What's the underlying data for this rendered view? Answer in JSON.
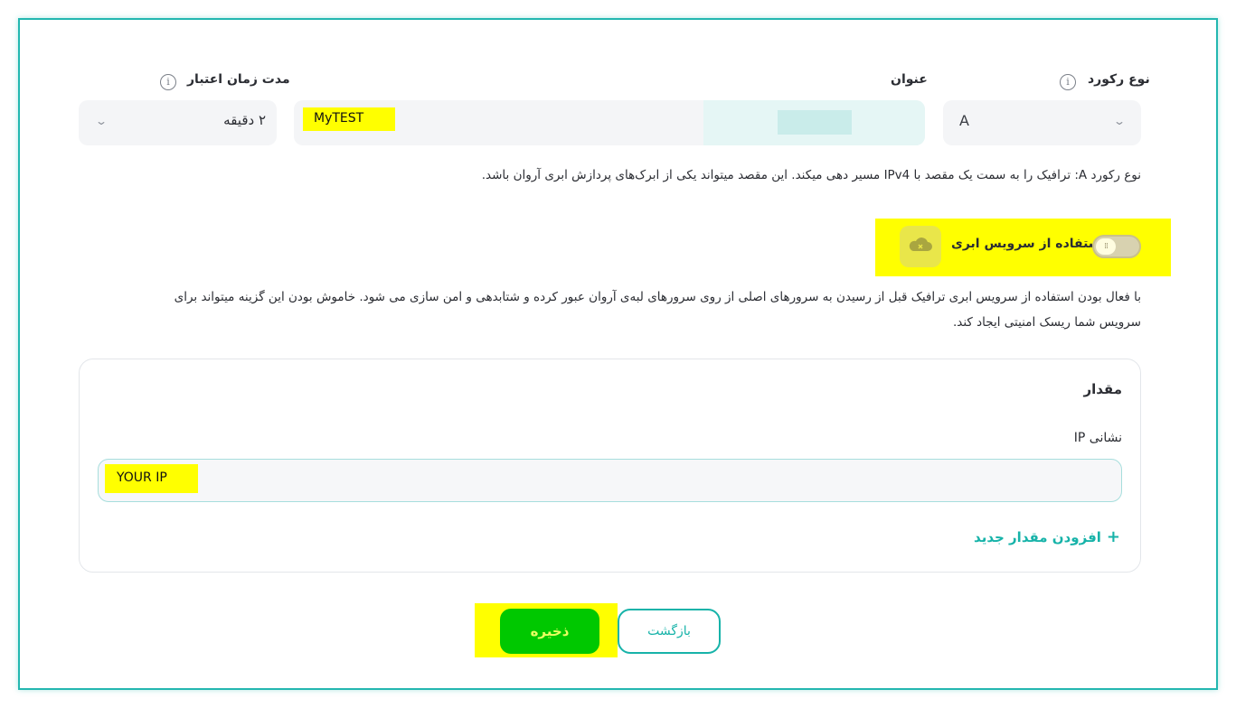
{
  "form": {
    "record_type": {
      "label": "نوع رکورد",
      "value": "A",
      "help": "نوع رکورد A: ترافیک را به سمت یک مقصد با IPv4 مسیر دهی میکند. این مقصد میتواند یکی از ابرک‌های پردازش ابری آروان باشد."
    },
    "title": {
      "label": "عنوان",
      "value": "MyTEST"
    },
    "ttl": {
      "label": "مدت زمان اعتبار",
      "value": "۲ دقیقه"
    },
    "cloud": {
      "label": "استفاده از سرویس ابری",
      "enabled": false,
      "help_line1": "با فعال بودن استفاده از سرویس ابری ترافیک قبل از رسیدن به سرورهای اصلی از روی سرورهای لبه‌ی آروان عبور کرده و شتابدهی و امن سازی می شود. خاموش بودن این گزینه میتواند برای",
      "help_line2": "سرویس شما ریسک امنیتی ایجاد کند."
    },
    "value_section": {
      "title": "مقدار",
      "ip_label": "نشانی IP",
      "ip_value": "YOUR IP",
      "add_label": "افزودن مقدار جدید",
      "add_symbol": "+"
    }
  },
  "actions": {
    "save": "ذخیره",
    "back": "بازگشت"
  },
  "icons": {
    "info": "info-icon",
    "chevron": "chevron-down-icon",
    "cloud": "cloud-off-icon",
    "plus": "plus-icon"
  },
  "colors": {
    "accent": "#17b3a9",
    "frame": "#23b7b0",
    "save": "#00c800",
    "highlight": "#ffff00"
  }
}
